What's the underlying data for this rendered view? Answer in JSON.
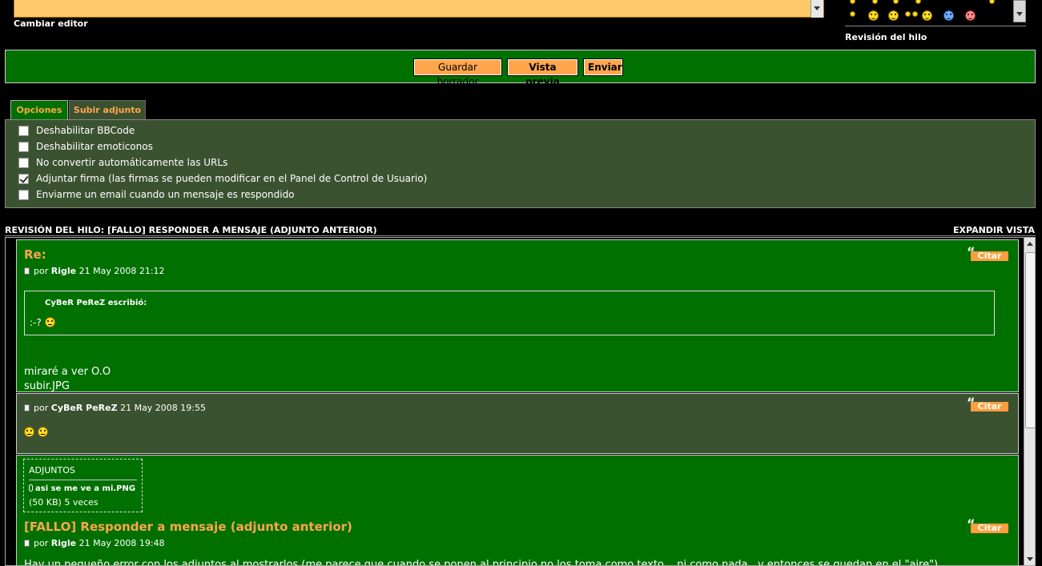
{
  "editor": {
    "change_editor_label": "Cambiar editor"
  },
  "sidebar": {
    "thread_review_label": "Revisión del hilo"
  },
  "actions": {
    "save_draft": "Guardar borrador",
    "preview": "Vista previa",
    "send": "Enviar"
  },
  "tabs": {
    "options": "Opciones",
    "upload": "Subir adjunto"
  },
  "options": [
    {
      "label": "Deshabilitar BBCode",
      "checked": false
    },
    {
      "label": "Deshabilitar emoticonos",
      "checked": false
    },
    {
      "label": "No convertir automáticamente las URLs",
      "checked": false
    },
    {
      "label": "Adjuntar firma (las firmas se pueden modificar en el Panel de Control de Usuario)",
      "checked": true
    },
    {
      "label": "Enviarme un email cuando un mensaje es respondido",
      "checked": false
    }
  ],
  "review": {
    "title": "REVISIÓN DEL HILO: [FALLO] RESPONDER A MENSAJE (ADJUNTO ANTERIOR)",
    "expand": "EXPANDIR VISTA",
    "quote_label": "Citar",
    "by_label": "por",
    "posts": [
      {
        "title": "Re:",
        "author": "Rigle",
        "date": "21 May 2008 21:12",
        "quote_author": "CyBeR PeReZ escribió:",
        "quote_text": ":-?",
        "body_line1": "miraré a ver O.O",
        "body_line2": "subir.JPG"
      },
      {
        "title": "",
        "author": "CyBeR PeReZ",
        "date": "21 May 2008 19:55"
      },
      {
        "attachments_title": "ADJUNTOS",
        "attachment_name": "asi se me ve a mi.PNG",
        "attachment_info": "(50 KB) 5 veces",
        "title": "[FALLO] Responder a mensaje (adjunto anterior)",
        "author": "Rigle",
        "date": "21 May 2008 19:48",
        "body_cut": "Hay un pequeño error con los adjuntos al mostrarlos (me parece que cuando se ponen al principio no los toma como texto... ni como nada.. y entonces se quedan en el \"aire\")"
      }
    ]
  },
  "colors": {
    "panel_green": "#007000",
    "panel_dark": "#3b5230",
    "accent_orange": "#ffa64d",
    "editor_bg": "#ffc869"
  }
}
